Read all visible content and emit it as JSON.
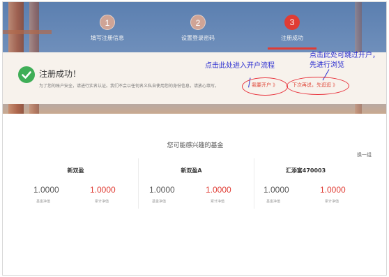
{
  "steps": [
    {
      "number": "1",
      "label": "填写注册信息",
      "state": "done"
    },
    {
      "number": "2",
      "label": "设置登录密码",
      "state": "done"
    },
    {
      "number": "3",
      "label": "注册成功",
      "state": "active"
    }
  ],
  "success": {
    "title": "注册成功！",
    "description": "为了您的账户安全，请进行实名认证。我们不会以任何名义私自使用您的身份信息，请放心填写。",
    "open_account_link": "我要开户 》",
    "skip_link": "下次再说，先逛逛 》"
  },
  "annotations": {
    "open_account": "点击此处进入开户流程",
    "skip_line1": "点击此处可跳过开户，",
    "skip_line2": "先进行浏览"
  },
  "funds_section": {
    "title": "您可能感兴趣的基金",
    "refresh_label": "换一组",
    "funds": [
      {
        "name": "新双盈",
        "unit_nav": "1.0000",
        "unit_nav_label": "基金净值",
        "acc_nav": "1.0000",
        "acc_nav_label": "累计净值"
      },
      {
        "name": "新双盈A",
        "unit_nav": "1.0000",
        "unit_nav_label": "基金净值",
        "acc_nav": "1.0000",
        "acc_nav_label": "累计净值"
      },
      {
        "name": "汇添富470003",
        "unit_nav": "1.0000",
        "unit_nav_label": "基金净值",
        "acc_nav": "1.0000",
        "acc_nav_label": "累计净值"
      }
    ]
  },
  "colors": {
    "accent": "#e03c34",
    "success": "#3fae57",
    "annotation": "#2b2ed0"
  },
  "icons": {
    "success": "check-circle-icon"
  }
}
